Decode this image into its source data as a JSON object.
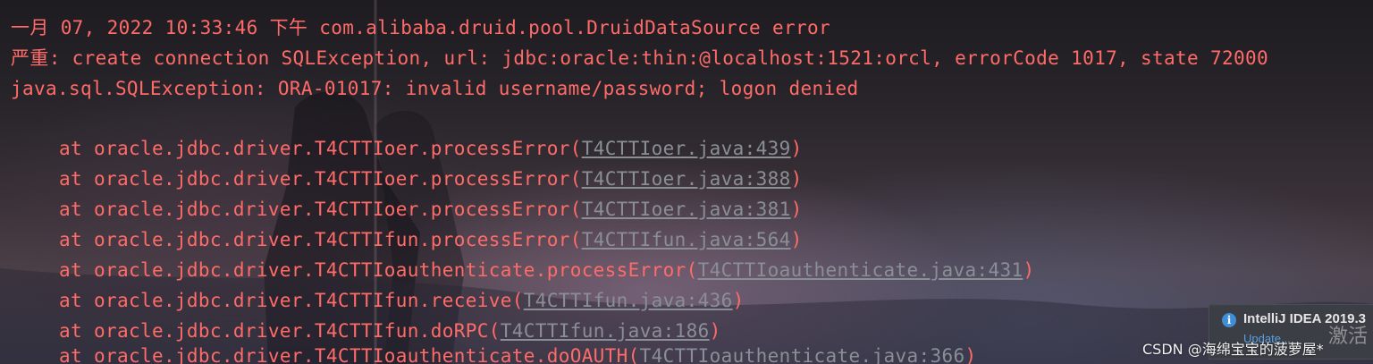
{
  "console": {
    "header": [
      "一月 07, 2022 10:33:46 下午 com.alibaba.druid.pool.DruidDataSource error",
      "严重: create connection SQLException, url: jdbc:oracle:thin:@localhost:1521:orcl, errorCode 1017, state 72000",
      "java.sql.SQLException: ORA-01017: invalid username/password; logon denied"
    ],
    "frames": [
      {
        "prefix": "at oracle.jdbc.driver.T4CTTIoer.processError(",
        "link": "T4CTTIoer.java:439",
        "suffix": ")"
      },
      {
        "prefix": "at oracle.jdbc.driver.T4CTTIoer.processError(",
        "link": "T4CTTIoer.java:388",
        "suffix": ")"
      },
      {
        "prefix": "at oracle.jdbc.driver.T4CTTIoer.processError(",
        "link": "T4CTTIoer.java:381",
        "suffix": ")"
      },
      {
        "prefix": "at oracle.jdbc.driver.T4CTTIfun.processError(",
        "link": "T4CTTIfun.java:564",
        "suffix": ")"
      },
      {
        "prefix": "at oracle.jdbc.driver.T4CTTIoauthenticate.processError(",
        "link": "T4CTTIoauthenticate.java:431",
        "suffix": ")"
      },
      {
        "prefix": "at oracle.jdbc.driver.T4CTTIfun.receive(",
        "link": "T4CTTIfun.java:436",
        "suffix": ")"
      },
      {
        "prefix": "at oracle.jdbc.driver.T4CTTIfun.doRPC(",
        "link": "T4CTTIfun.java:186",
        "suffix": ")"
      },
      {
        "prefix": "at oracle.jdbc.driver.T4CTTIoauthenticate.doOAUTH(",
        "link": "T4CTTIoauthenticate.java:366",
        "suffix": ")"
      }
    ]
  },
  "notification": {
    "icon": "info-icon",
    "icon_glyph": "i",
    "title": "IntelliJ IDEA 2019.3",
    "link": "Update..."
  },
  "watermark": {
    "text": "CSDN @海绵宝宝的菠萝屋*"
  },
  "activate_hint": {
    "text": "激活"
  },
  "colors": {
    "error_text": "#ff6b68",
    "link_text": "#8a8f96",
    "info_icon": "#3e8fd8",
    "notification_link": "#5a9fe0"
  }
}
